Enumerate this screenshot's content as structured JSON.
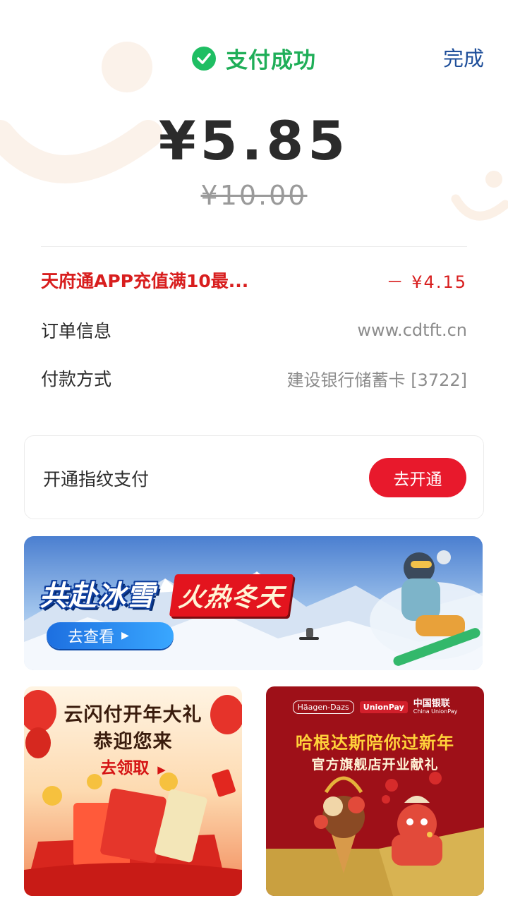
{
  "header": {
    "status_text": "支付成功",
    "done_label": "完成"
  },
  "payment": {
    "amount": "¥5.85",
    "original_amount": "¥10.00"
  },
  "details": {
    "promo_label": "天府通APP充值满10最...",
    "promo_value": "－ ¥4.15",
    "order_label": "订单信息",
    "order_value": "www.cdtft.cn",
    "method_label": "付款方式",
    "method_value": "建设银行储蓄卡 [3722]"
  },
  "fingerprint": {
    "label": "开通指纹支付",
    "button": "去开通"
  },
  "banner": {
    "title_left": "共赴冰雪",
    "title_right": "火热冬天",
    "button": "去查看"
  },
  "promo_cards": {
    "left": {
      "line1": "云闪付开年大礼",
      "line2": "恭迎您来",
      "cta": "去领取"
    },
    "right": {
      "brand_left": "Häagen-Dazs",
      "brand_mid": "UnionPay",
      "brand_right_cn": "中国银联",
      "brand_right_en": "China UnionPay",
      "headline": "哈根达斯陪你过新年",
      "subline": "官方旗舰店开业献礼"
    }
  },
  "colors": {
    "success_green": "#1fbe63",
    "accent_red": "#e8192c",
    "link_blue": "#1f4f9a"
  }
}
